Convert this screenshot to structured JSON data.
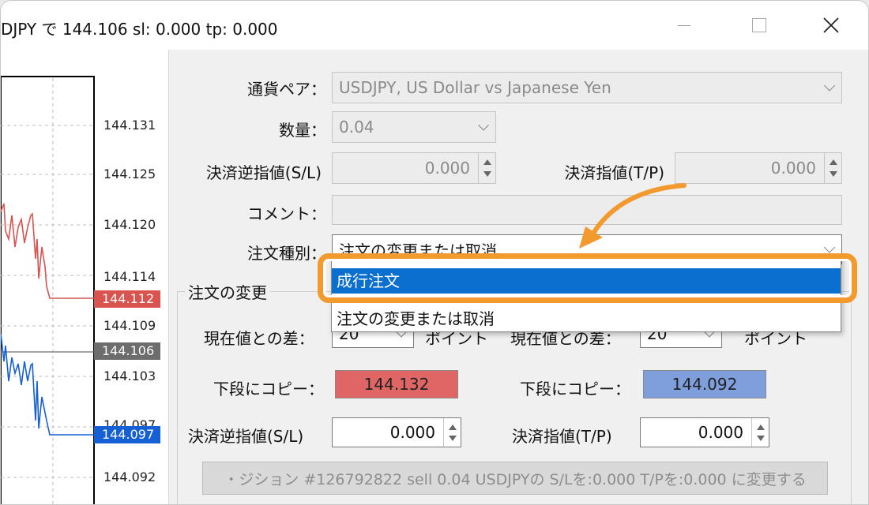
{
  "window": {
    "title": "DJPY で 144.106 sl: 0.000 tp: 0.000"
  },
  "chart": {
    "price_labels": [
      "144.131",
      "144.125",
      "144.120",
      "144.114",
      "144.109",
      "144.103",
      "144.097",
      "144.092"
    ],
    "bid_tag": "144.112",
    "last_tag": "144.106",
    "ask_tag": "144.097",
    "colors": {
      "bid": "#d9534f",
      "ask": "#1560d4",
      "last": "#6d6d6d"
    }
  },
  "form": {
    "symbol_label": "通貨ペア：",
    "symbol_value": "USDJPY, US Dollar vs Japanese Yen",
    "volume_label": "数量：",
    "volume_value": "0.04",
    "sl_label": "決済逆指値(S/L)",
    "sl_value": "0.000",
    "tp_label": "決済指値(T/P)",
    "tp_value": "0.000",
    "comment_label": "コメント：",
    "comment_value": "",
    "type_label": "注文種別：",
    "type_value": "注文の変更または取消"
  },
  "modify": {
    "group_title": "注文の変更",
    "diff_label": "現在値との差：",
    "diff_value": "20",
    "points_label": "ポイント",
    "diff_label2": "現在値との差：",
    "diff_value2": "20",
    "points_label2": "ポイント",
    "copy_label": "下段にコピー：",
    "copy_sell_value": "144.132",
    "copy_label2": "下段にコピー：",
    "copy_buy_value": "144.092",
    "sl_label": "決済逆指値(S/L)",
    "sl_value": "0.000",
    "tp_label": "決済指値(T/P)",
    "tp_value": "0.000",
    "action_button": "・ジション #126792822 sell 0.04 USDJPYの S/Lを:0.000 T/Pを:0.000 に変更する",
    "colors": {
      "sell_copy": "#e06666",
      "buy_copy": "#7f9fdc"
    }
  },
  "dropdown": {
    "options": [
      "成行注文",
      "注文の変更または取消"
    ],
    "selected_index": 0,
    "accent": "#f29a2e"
  }
}
